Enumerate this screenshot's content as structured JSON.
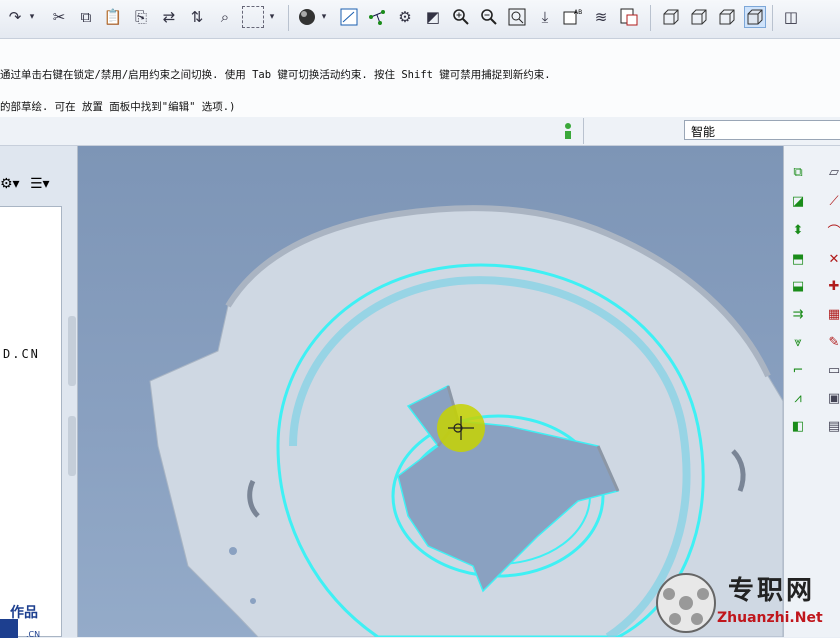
{
  "toolbar": {
    "icons": [
      "redo-icon",
      "dropdown-icon",
      "cut-icon",
      "copy-icon",
      "paste-icon",
      "paste-special-icon",
      "regenerate-icon",
      "regenerate-manager-icon",
      "find-icon",
      "select-box-icon",
      "select-dropdown-icon",
      "shading-sphere-icon",
      "appearance-dropdown-icon",
      "saved-view-icon",
      "datum-points-icon",
      "spin-center-icon",
      "orient-icon",
      "zoom-in-icon",
      "zoom-out-icon",
      "refit-icon",
      "repaint-icon",
      "annotation-icon",
      "layers-icon",
      "view-manager-icon",
      "wireframe-icon",
      "hidden-line-icon",
      "no-hidden-icon",
      "shading-icon"
    ]
  },
  "messages": {
    "line1": "通过单击右键在锁定/禁用/启用约束之间切换. 使用 Tab 键可切换活动约束. 按住 Shift 键可禁用捕捉到新约束.",
    "line2": "的部草绘. 可在 放置 面板中找到\"编辑\" 选项.)"
  },
  "statusbar": {
    "filter_value": "智能"
  },
  "left_panel": {
    "fragment_text": "D.CN"
  },
  "watermark": {
    "cn": "专职网",
    "en": "Zhuanzhi.Net"
  },
  "colors": {
    "viewport_bg": "#8aa1c1",
    "model_fill": "#cfd8e3",
    "highlight_cyan": "#3ff0f4",
    "cursor_yellow": "#c7d400",
    "watermark_red": "#c0161c"
  }
}
